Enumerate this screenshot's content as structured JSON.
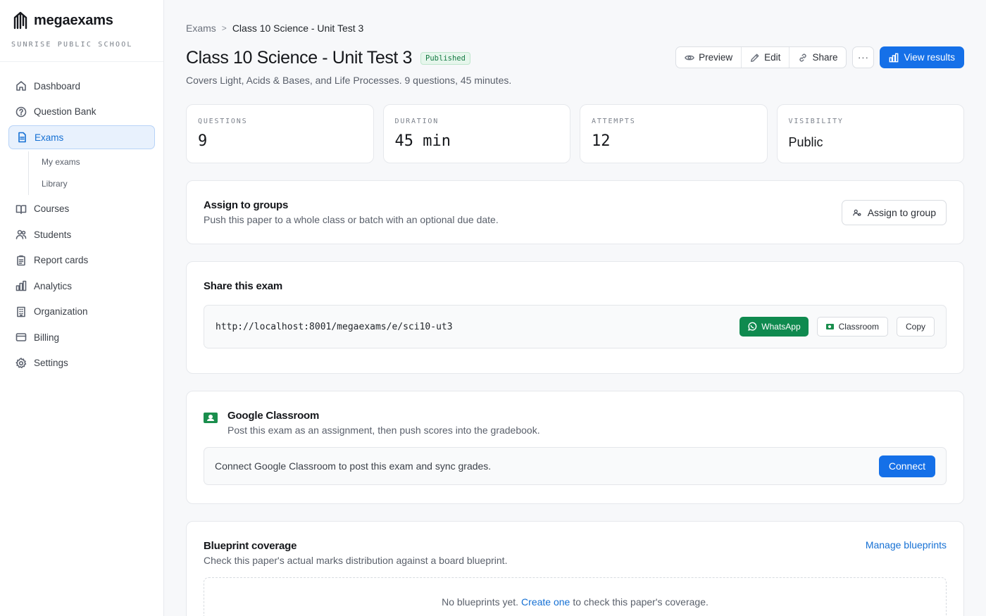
{
  "brand": {
    "name": "megaexams",
    "org": "SUNRISE PUBLIC SCHOOL"
  },
  "nav": {
    "items": [
      {
        "label": "Dashboard"
      },
      {
        "label": "Question Bank"
      },
      {
        "label": "Exams"
      },
      {
        "label": "Courses"
      },
      {
        "label": "Students"
      },
      {
        "label": "Report cards"
      },
      {
        "label": "Analytics"
      },
      {
        "label": "Organization"
      },
      {
        "label": "Billing"
      },
      {
        "label": "Settings"
      }
    ],
    "sub": [
      {
        "label": "My exams"
      },
      {
        "label": "Library"
      }
    ]
  },
  "breadcrumb": {
    "root": "Exams",
    "separator": ">",
    "current": "Class 10 Science - Unit Test 3"
  },
  "page": {
    "title": "Class 10 Science - Unit Test 3",
    "status": "Published",
    "subtitle": "Covers Light, Acids & Bases, and Life Processes. 9 questions, 45 minutes."
  },
  "toolbar": {
    "preview": "Preview",
    "edit": "Edit",
    "share": "Share",
    "more": "···",
    "view_results": "View results"
  },
  "stats": [
    {
      "label": "QUESTIONS",
      "value": "9"
    },
    {
      "label": "DURATION",
      "value": "45 min"
    },
    {
      "label": "ATTEMPTS",
      "value": "12"
    },
    {
      "label": "VISIBILITY",
      "value": "Public"
    }
  ],
  "assign": {
    "title": "Assign to groups",
    "desc": "Push this paper to a whole class or batch with an optional due date.",
    "button": "Assign to group"
  },
  "share": {
    "title": "Share this exam",
    "url": "http://localhost:8001/megaexams/e/sci10-ut3",
    "whatsapp": "WhatsApp",
    "classroom": "Classroom",
    "copy": "Copy"
  },
  "classroom": {
    "title": "Google Classroom",
    "desc": "Post this exam as an assignment, then push scores into the gradebook.",
    "message": "Connect Google Classroom to post this exam and sync grades.",
    "connect": "Connect"
  },
  "blueprint": {
    "title": "Blueprint coverage",
    "desc": "Check this paper's actual marks distribution against a board blueprint.",
    "manage": "Manage blueprints",
    "empty_prefix": "No blueprints yet.",
    "empty_link": "Create one",
    "empty_suffix": "to check this paper's coverage."
  },
  "colors": {
    "accent": "#1570e8",
    "success": "#0f8a4f",
    "active_bg": "#e8f1fd"
  }
}
